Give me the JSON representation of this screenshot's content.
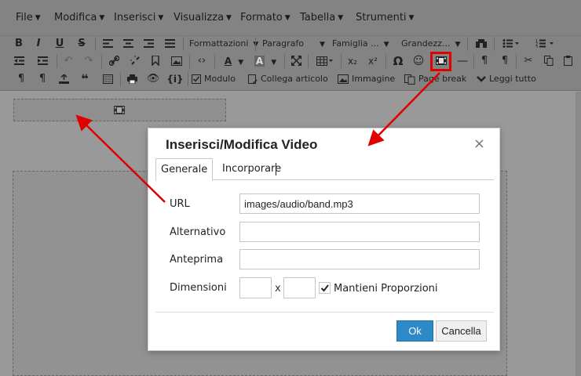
{
  "menubar": {
    "items": [
      {
        "label": "File"
      },
      {
        "label": "Modifica"
      },
      {
        "label": "Inserisci"
      },
      {
        "label": "Visualizza"
      },
      {
        "label": "Formato"
      },
      {
        "label": "Tabella"
      },
      {
        "label": "Strumenti"
      }
    ]
  },
  "toolbar": {
    "row1": {
      "bold": "B",
      "italic": "I",
      "underline": "U",
      "strike": "S",
      "formats_label": "Formattazioni",
      "paragraph_label": "Paragrafo",
      "font_family_label": "Famiglia ...",
      "font_size_label": "Grandezz..."
    },
    "row2": {
      "subscript": "x₂",
      "superscript": "x²",
      "omega": "Ω"
    },
    "row3": {
      "module_label": "Modulo",
      "link_article_label": "Collega articolo",
      "image_label": "Immagine",
      "page_break_label": "Page break",
      "read_all_label": "Leggi tutto"
    }
  },
  "dialog": {
    "title": "Inserisci/Modifica Video",
    "close": "×",
    "tabs": [
      {
        "label": "Generale",
        "active": true
      },
      {
        "label": "Incorporare",
        "active": false
      }
    ],
    "fields": {
      "url_label": "URL",
      "url_value": "images/audio/band.mp3",
      "alt_label": "Alternativo",
      "alt_value": "",
      "poster_label": "Anteprima",
      "poster_value": "",
      "dimensions_label": "Dimensioni",
      "width_value": "",
      "height_value": "",
      "times": "x",
      "keep_ratio_label": "Mantieni Proporzioni",
      "keep_ratio_checked": true
    },
    "buttons": {
      "ok": "Ok",
      "cancel": "Cancella"
    }
  },
  "colors": {
    "accent": "#2d8ac7",
    "annotation": "#e00000"
  }
}
